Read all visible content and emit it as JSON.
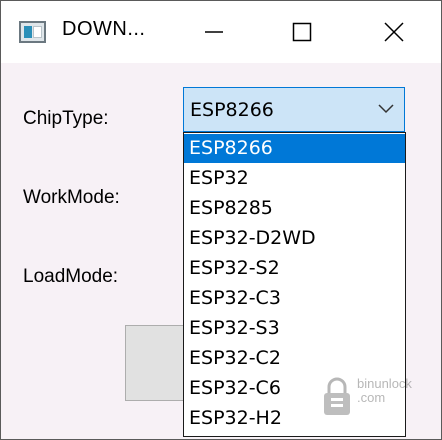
{
  "window": {
    "title": "DOWN..."
  },
  "form": {
    "chip_type_label": "ChipType:",
    "work_mode_label": "WorkMode:",
    "load_mode_label": "LoadMode:"
  },
  "chip_combo": {
    "selected": "ESP8266",
    "options": [
      "ESP8266",
      "ESP32",
      "ESP8285",
      "ESP32-D2WD",
      "ESP32-S2",
      "ESP32-C3",
      "ESP32-S3",
      "ESP32-C2",
      "ESP32-C6",
      "ESP32-H2"
    ],
    "highlighted_index": 0
  },
  "colors": {
    "accent": "#0078d7",
    "combo_focus_bg": "#cce4f7",
    "window_bg": "#f7f1f6"
  },
  "watermark": {
    "line1": "binunlock",
    "line2": ".com"
  }
}
